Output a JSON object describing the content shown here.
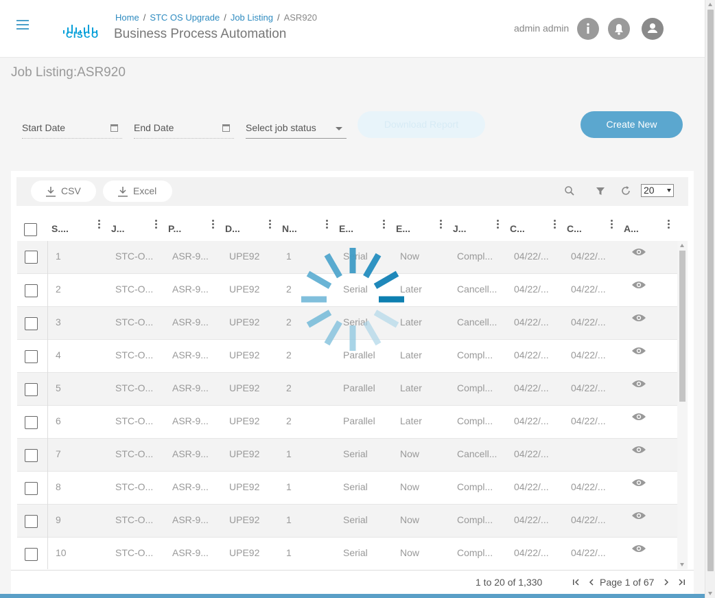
{
  "header": {
    "breadcrumb": [
      "Home",
      "STC OS Upgrade",
      "Job Listing",
      "ASR920"
    ],
    "logo_text": "CISCO",
    "app_title": "Business Process Automation",
    "user_name": "admin admin",
    "icons": [
      "info-icon",
      "bell-icon",
      "user-icon"
    ]
  },
  "page_title": "Job Listing:ASR920",
  "filters": {
    "start_date": "Start Date",
    "end_date": "End Date",
    "job_status": "Select job status",
    "download_label": "Download Report",
    "create_label": "Create New"
  },
  "toolbar": {
    "csv_label": "CSV",
    "excel_label": "Excel",
    "page_size": "20"
  },
  "columns": [
    "S....",
    "J...",
    "P...",
    "D...",
    "N...",
    "E...",
    "E...",
    "J...",
    "C...",
    "C...",
    "A..."
  ],
  "rows": [
    [
      "1",
      "STC-O...",
      "ASR-9...",
      "UPE92",
      "1",
      "Serial",
      "Now",
      "Compl...",
      "04/22/...",
      "04/22/..."
    ],
    [
      "2",
      "STC-O...",
      "ASR-9...",
      "UPE92",
      "2",
      "Serial",
      "Later",
      "Cancell...",
      "04/22/...",
      "04/22/..."
    ],
    [
      "3",
      "STC-O...",
      "ASR-9...",
      "UPE92",
      "2",
      "Serial",
      "Later",
      "Cancell...",
      "04/22/...",
      "04/22/..."
    ],
    [
      "4",
      "STC-O...",
      "ASR-9...",
      "UPE92",
      "2",
      "Parallel",
      "Later",
      "Compl...",
      "04/22/...",
      "04/22/..."
    ],
    [
      "5",
      "STC-O...",
      "ASR-9...",
      "UPE92",
      "2",
      "Parallel",
      "Later",
      "Compl...",
      "04/22/...",
      "04/22/..."
    ],
    [
      "6",
      "STC-O...",
      "ASR-9...",
      "UPE92",
      "2",
      "Parallel",
      "Later",
      "Compl...",
      "04/22/...",
      "04/22/..."
    ],
    [
      "7",
      "STC-O...",
      "ASR-9...",
      "UPE92",
      "1",
      "Serial",
      "Now",
      "Cancell...",
      "04/22/...",
      ""
    ],
    [
      "8",
      "STC-O...",
      "ASR-9...",
      "UPE92",
      "1",
      "Serial",
      "Now",
      "Compl...",
      "04/22/...",
      "04/22/..."
    ],
    [
      "9",
      "STC-O...",
      "ASR-9...",
      "UPE92",
      "1",
      "Serial",
      "Now",
      "Compl...",
      "04/22/...",
      "04/22/..."
    ],
    [
      "10",
      "STC-O...",
      "ASR-9...",
      "UPE92",
      "1",
      "Serial",
      "Now",
      "Compl...",
      "04/22/...",
      "04/22/..."
    ]
  ],
  "footer": {
    "summary": "1 to 20 of 1,330",
    "page_label": "Page 1 of 67"
  },
  "colors": {
    "accent": "#5ba7cf",
    "link": "#2e8bc0",
    "spinner": "#0d7fb0"
  }
}
